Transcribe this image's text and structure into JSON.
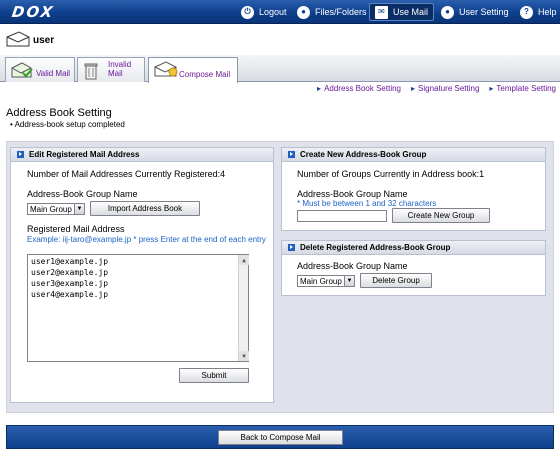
{
  "app": {
    "logo": "DOX"
  },
  "nav": {
    "logout": "Logout",
    "files": "Files/Folders",
    "use_mail": "Use Mail",
    "user_setting": "User Setting",
    "help": "Help"
  },
  "user": {
    "name": "user"
  },
  "tabs": [
    {
      "label": "Valid Mail"
    },
    {
      "label": "Invalid Mail"
    },
    {
      "label": "Compose Mail"
    }
  ],
  "sublinks": [
    "Address Book Setting",
    "Signature Setting",
    "Template Setting"
  ],
  "page": {
    "title": "Address Book Setting",
    "status": "Address-book setup completed"
  },
  "edit_panel": {
    "title": "Edit Registered Mail Address",
    "count_text": "Number of Mail Addresses Currently Registered:4",
    "group_label": "Address-Book Group Name",
    "group_value": "Main Group",
    "import_button": "Import Address Book",
    "registered_label": "Registered Mail Address",
    "example_note": "Example: iij-taro@example.jp * press Enter at the end of each entry",
    "addresses": [
      "user1@example.jp",
      "user2@example.jp",
      "user3@example.jp",
      "user4@example.jp"
    ],
    "submit_button": "Submit"
  },
  "create_panel": {
    "title": "Create New Address-Book Group",
    "count_text": "Number of Groups Currently in Address book:1",
    "group_label": "Address-Book Group Name",
    "constraint_note": "* Must be between 1 and 32 characters",
    "create_button": "Create New Group"
  },
  "delete_panel": {
    "title": "Delete Registered Address-Book Group",
    "group_label": "Address-Book Group Name",
    "group_value": "Main Group",
    "delete_button": "Delete Group"
  },
  "footer": {
    "back_button": "Back to Compose Mail"
  }
}
